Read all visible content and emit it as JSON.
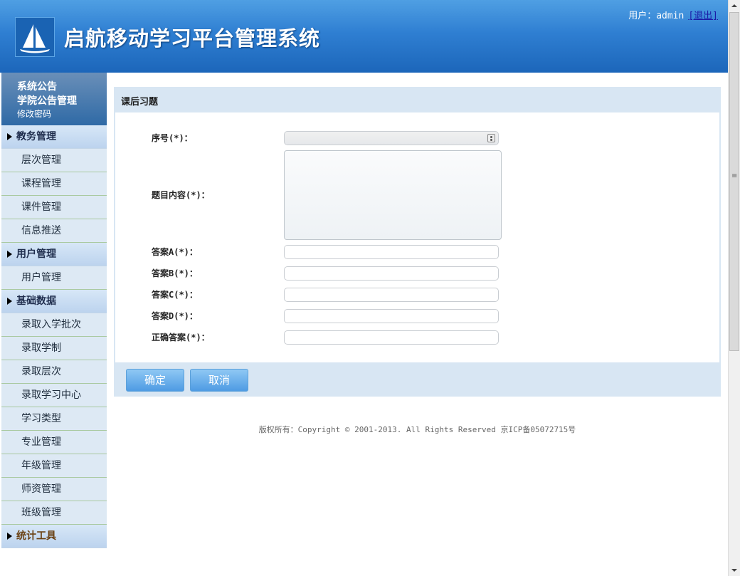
{
  "header": {
    "title": "启航移动学习平台管理系统",
    "user_label": "用户：admin",
    "logout": "[退出]"
  },
  "sidebar": {
    "top": [
      "系统公告",
      "学院公告管理",
      "修改密码"
    ],
    "groups": [
      {
        "label": "教务管理",
        "items": [
          "层次管理",
          "课程管理",
          "课件管理",
          "信息推送"
        ]
      },
      {
        "label": "用户管理",
        "items": [
          "用户管理"
        ]
      },
      {
        "label": "基础数据",
        "items": [
          "录取入学批次",
          "录取学制",
          "录取层次",
          "录取学习中心",
          "学习类型",
          "专业管理",
          "年级管理",
          "师资管理",
          "班级管理"
        ]
      },
      {
        "label": "统计工具",
        "items": []
      }
    ]
  },
  "panel": {
    "title": "课后习题",
    "fields": {
      "seq": "序号(*)：",
      "content": "题目内容(*)：",
      "a": "答案A(*)：",
      "b": "答案B(*)：",
      "c": "答案C(*)：",
      "d": "答案D(*)：",
      "correct": "正确答案(*)："
    },
    "confirm": "确定",
    "cancel": "取消"
  },
  "footer": "版权所有：Copyright © 2001-2013. All Rights Reserved 京ICP备05072715号"
}
